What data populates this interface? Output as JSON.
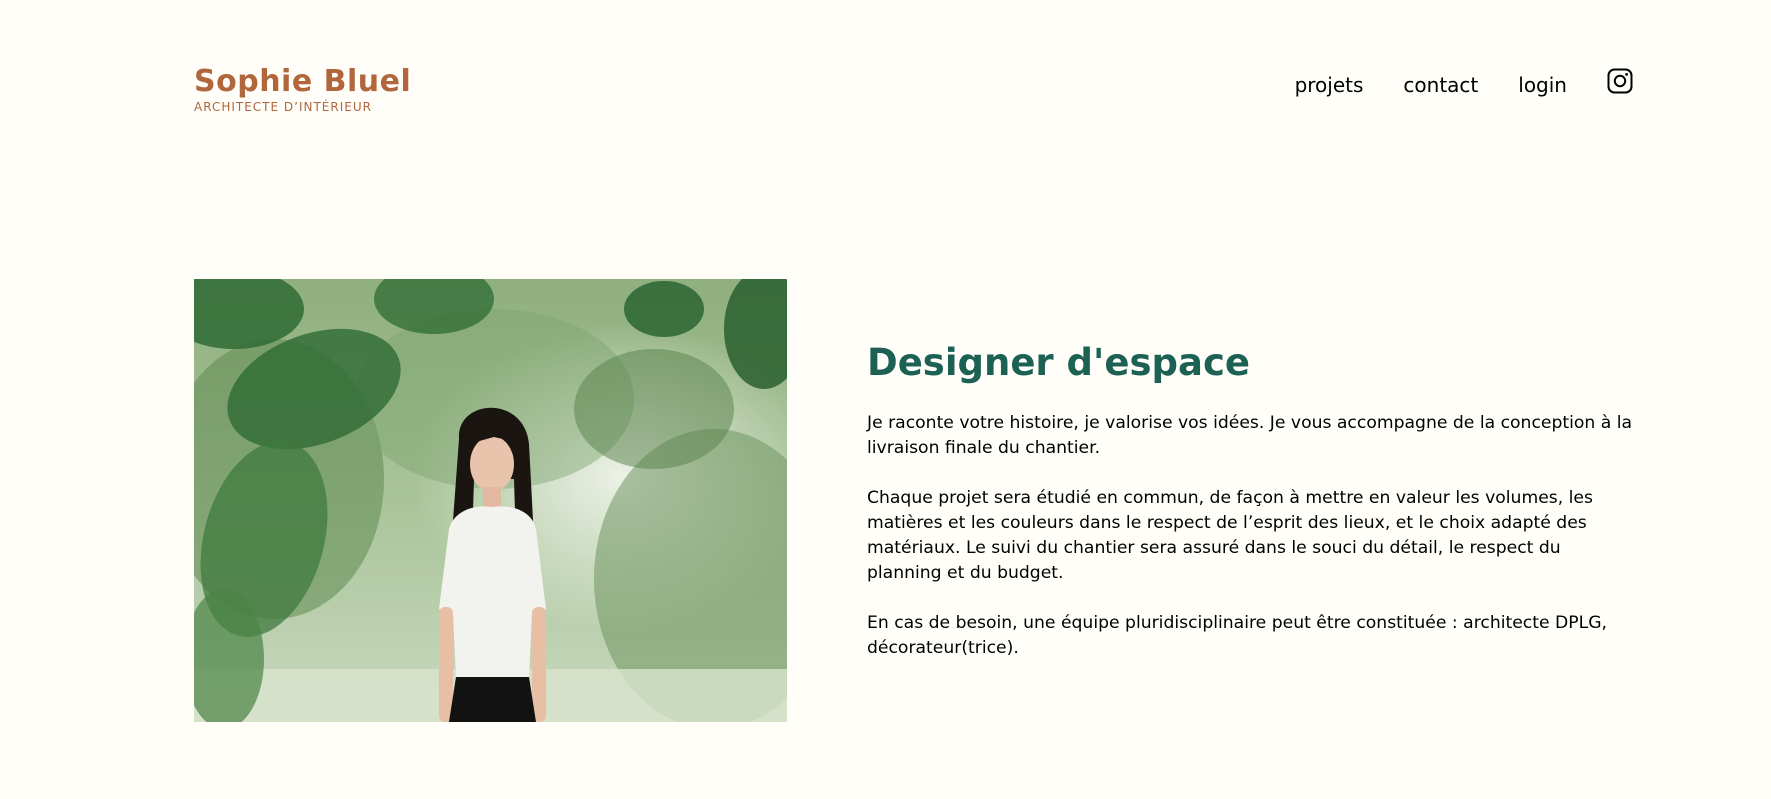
{
  "header": {
    "brand_title": "Sophie Bluel",
    "brand_subtitle": "ARCHITECTE D’INTÉRIEUR",
    "nav": {
      "projets": "projets",
      "contact": "contact",
      "login": "login"
    },
    "instagram_icon": "instagram-icon"
  },
  "introduction": {
    "photo": "portrait-photo",
    "title": "Designer d'espace",
    "paragraphs": [
      "Je raconte votre histoire, je valorise vos idées. Je vous accompagne de la conception à la livraison finale du chantier.",
      "Chaque projet sera étudié en commun, de façon à mettre en valeur les volumes, les matières et les couleurs dans le respect de l’esprit des lieux, et le choix adapté des matériaux. Le suivi du chantier sera assuré dans le souci du détail, le respect du planning et du budget.",
      "En cas de besoin, une équipe pluridisciplinaire peut être constituée : architecte DPLG, décorateur(trice)."
    ]
  },
  "colors": {
    "background": "#FFFEF8",
    "brand": "#B1663C",
    "title": "#1D6154",
    "text": "#000000"
  }
}
